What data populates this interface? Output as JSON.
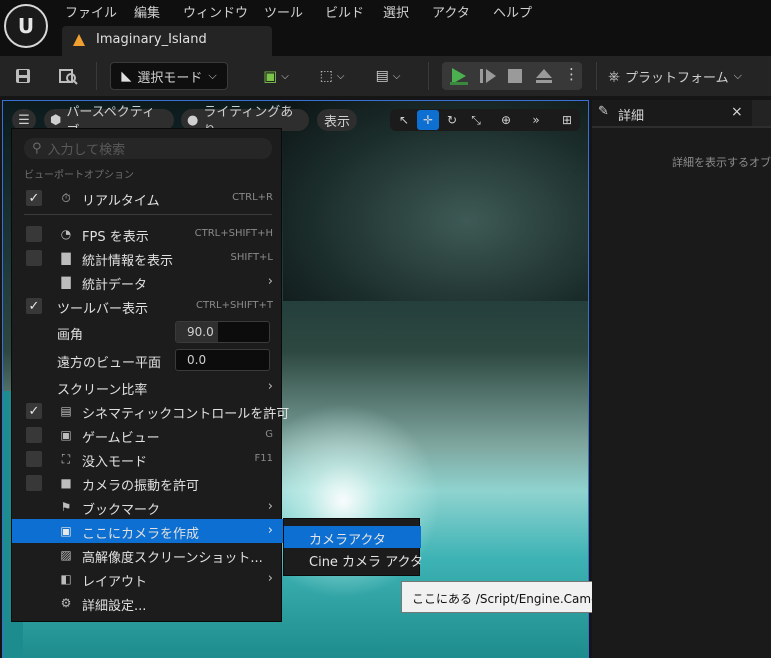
{
  "menubar": {
    "items": [
      "ファイル",
      "編集",
      "ウィンドウ",
      "ツール",
      "ビルド",
      "選択",
      "アクタ",
      "ヘルプ"
    ]
  },
  "document_tab": {
    "label": "Imaginary_Island"
  },
  "toolbar": {
    "mode_label": "選択モード",
    "platform_label": "プラットフォーム"
  },
  "viewport": {
    "perspective_label": "パースペクティブ",
    "lighting_label": "ライティングあり",
    "show_label": "表示"
  },
  "viewport_menu": {
    "search_placeholder": "入力して検索",
    "section_title": "ビューポートオプション",
    "items": [
      {
        "label": "リアルタイム",
        "shortcut": "CTRL+R",
        "checked": true,
        "icon": "realtime-icon"
      },
      {
        "label": "FPS を表示",
        "shortcut": "CTRL+SHIFT+H",
        "checked": false,
        "icon": "fps-icon"
      },
      {
        "label": "統計情報を表示",
        "shortcut": "SHIFT+L",
        "checked": false,
        "icon": "stats-icon"
      },
      {
        "label": "統計データ",
        "shortcut": "",
        "checked": null,
        "icon": "stats-icon"
      },
      {
        "label": "ツールバー表示",
        "shortcut": "CTRL+SHIFT+T",
        "checked": true,
        "icon": ""
      },
      {
        "label": "画角",
        "value": "90.0",
        "fill": 0.45
      },
      {
        "label": "遠方のビュー平面",
        "value": "0.0",
        "fill": 0
      },
      {
        "label": "スクリーン比率"
      },
      {
        "label": "シネマティックコントロールを許可",
        "shortcut": "",
        "checked": true,
        "icon": "clapper-icon"
      },
      {
        "label": "ゲームビュー",
        "shortcut": "G",
        "checked": false,
        "icon": "game-view-icon"
      },
      {
        "label": "没入モード",
        "shortcut": "F11",
        "checked": false,
        "icon": "immersive-icon"
      },
      {
        "label": "カメラの振動を許可",
        "shortcut": "",
        "checked": false,
        "icon": "camera-shake-icon"
      },
      {
        "label": "ブックマーク",
        "icon": "bookmark-icon"
      },
      {
        "label": "ここにカメラを作成",
        "icon": "create-camera-icon"
      },
      {
        "label": "高解像度スクリーンショット...",
        "icon": "screenshot-icon"
      },
      {
        "label": "レイアウト",
        "icon": "layout-icon"
      },
      {
        "label": "詳細設定...",
        "icon": "settings-icon"
      }
    ]
  },
  "camera_submenu": {
    "items": [
      "カメラアクタ",
      "Cine カメラ アクタ"
    ]
  },
  "tooltip": {
    "text": "ここにある /Script/Engine.CameraActor タイプのスポーン カメラ"
  },
  "details_panel": {
    "tab_label": "詳細",
    "close_glyph": "×",
    "hint": "詳細を表示するオブジェ"
  },
  "colors": {
    "accent": "#0c6fd1",
    "viewport_border": "#3a6fd6",
    "play_green": "#4caf50"
  }
}
